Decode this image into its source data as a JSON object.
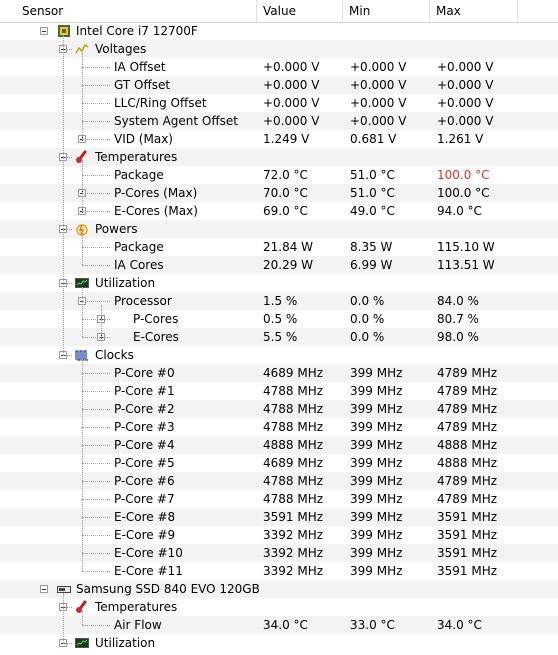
{
  "columns": {
    "sensor": "Sensor",
    "value": "Value",
    "min": "Min",
    "max": "Max"
  },
  "devices": [
    {
      "name": "Intel Core i7 12700F",
      "icon": "cpu-chip-icon"
    },
    {
      "name": "Samsung SSD 840 EVO 120GB",
      "icon": "ssd-drive-icon"
    }
  ],
  "groups": {
    "voltages": "Voltages",
    "temperatures": "Temperatures",
    "powers": "Powers",
    "utilization": "Utilization",
    "clocks": "Clocks",
    "ssd_temperatures": "Temperatures",
    "ssd_utilization": "Utilization"
  },
  "voltages": [
    {
      "name": "IA Offset",
      "value": "+0.000 V",
      "min": "+0.000 V",
      "max": "+0.000 V"
    },
    {
      "name": "GT Offset",
      "value": "+0.000 V",
      "min": "+0.000 V",
      "max": "+0.000 V"
    },
    {
      "name": "LLC/Ring Offset",
      "value": "+0.000 V",
      "min": "+0.000 V",
      "max": "+0.000 V"
    },
    {
      "name": "System Agent Offset",
      "value": "+0.000 V",
      "min": "+0.000 V",
      "max": "+0.000 V"
    },
    {
      "name": "VID (Max)",
      "value": "1.249 V",
      "min": "0.681 V",
      "max": "1.261 V"
    }
  ],
  "temperatures": [
    {
      "name": "Package",
      "value": "72.0 °C",
      "min": "51.0 °C",
      "max": "100.0 °C"
    },
    {
      "name": "P-Cores (Max)",
      "value": "70.0 °C",
      "min": "51.0 °C",
      "max": "100.0 °C"
    },
    {
      "name": "E-Cores (Max)",
      "value": "69.0 °C",
      "min": "49.0 °C",
      "max": "94.0 °C"
    }
  ],
  "powers": [
    {
      "name": "Package",
      "value": "21.84 W",
      "min": "8.35 W",
      "max": "115.10 W"
    },
    {
      "name": "IA Cores",
      "value": "20.29 W",
      "min": "6.99 W",
      "max": "113.51 W"
    }
  ],
  "utilization": [
    {
      "name": "Processor",
      "value": "1.5 %",
      "min": "0.0 %",
      "max": "84.0 %"
    },
    {
      "name": "P-Cores",
      "value": "0.5 %",
      "min": "0.0 %",
      "max": "80.7 %"
    },
    {
      "name": "E-Cores",
      "value": "5.5 %",
      "min": "0.0 %",
      "max": "98.0 %"
    }
  ],
  "clocks": [
    {
      "name": "P-Core #0",
      "value": "4689 MHz",
      "min": "399 MHz",
      "max": "4789 MHz"
    },
    {
      "name": "P-Core #1",
      "value": "4788 MHz",
      "min": "399 MHz",
      "max": "4789 MHz"
    },
    {
      "name": "P-Core #2",
      "value": "4788 MHz",
      "min": "399 MHz",
      "max": "4789 MHz"
    },
    {
      "name": "P-Core #3",
      "value": "4788 MHz",
      "min": "399 MHz",
      "max": "4789 MHz"
    },
    {
      "name": "P-Core #4",
      "value": "4888 MHz",
      "min": "399 MHz",
      "max": "4888 MHz"
    },
    {
      "name": "P-Core #5",
      "value": "4689 MHz",
      "min": "399 MHz",
      "max": "4888 MHz"
    },
    {
      "name": "P-Core #6",
      "value": "4788 MHz",
      "min": "399 MHz",
      "max": "4789 MHz"
    },
    {
      "name": "P-Core #7",
      "value": "4788 MHz",
      "min": "399 MHz",
      "max": "4789 MHz"
    },
    {
      "name": "E-Core #8",
      "value": "3591 MHz",
      "min": "399 MHz",
      "max": "3591 MHz"
    },
    {
      "name": "E-Core #9",
      "value": "3392 MHz",
      "min": "399 MHz",
      "max": "3591 MHz"
    },
    {
      "name": "E-Core #10",
      "value": "3392 MHz",
      "min": "399 MHz",
      "max": "3591 MHz"
    },
    {
      "name": "E-Core #11",
      "value": "3392 MHz",
      "min": "399 MHz",
      "max": "3591 MHz"
    }
  ],
  "ssd_temperatures": [
    {
      "name": "Air Flow",
      "value": "34.0 °C",
      "min": "33.0 °C",
      "max": "34.0 °C"
    }
  ],
  "colors": {
    "highlight": "#e03030",
    "alt_row": "#f3f3f3"
  }
}
